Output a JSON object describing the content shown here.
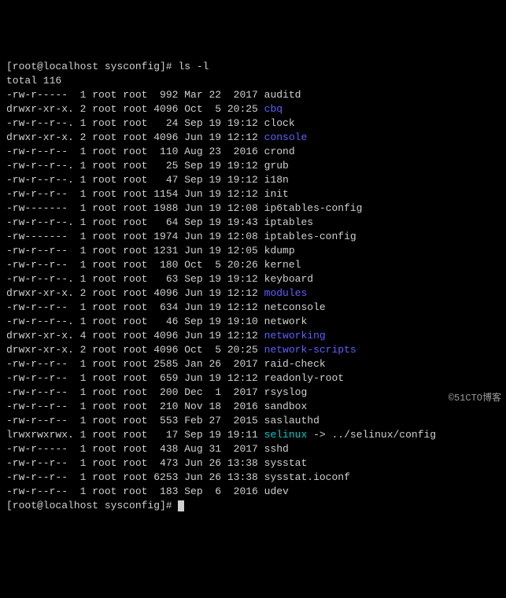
{
  "prompt": {
    "user": "root",
    "host": "localhost",
    "cwd": "sysconfig",
    "symbol": "#"
  },
  "command": "ls -l",
  "total_line": "total 116",
  "files": [
    {
      "perms": "-rw-r-----",
      "links": "1",
      "owner": "root",
      "group": "root",
      "size": "992",
      "date": "Mar 22  2017",
      "name": "auditd",
      "type": "file"
    },
    {
      "perms": "drwxr-xr-x.",
      "links": "2",
      "owner": "root",
      "group": "root",
      "size": "4096",
      "date": "Oct  5 20:25",
      "name": "cbq",
      "type": "dir"
    },
    {
      "perms": "-rw-r--r--.",
      "links": "1",
      "owner": "root",
      "group": "root",
      "size": "24",
      "date": "Sep 19 19:12",
      "name": "clock",
      "type": "file"
    },
    {
      "perms": "drwxr-xr-x.",
      "links": "2",
      "owner": "root",
      "group": "root",
      "size": "4096",
      "date": "Jun 19 12:12",
      "name": "console",
      "type": "dir"
    },
    {
      "perms": "-rw-r--r--",
      "links": "1",
      "owner": "root",
      "group": "root",
      "size": "110",
      "date": "Aug 23  2016",
      "name": "crond",
      "type": "file"
    },
    {
      "perms": "-rw-r--r--.",
      "links": "1",
      "owner": "root",
      "group": "root",
      "size": "25",
      "date": "Sep 19 19:12",
      "name": "grub",
      "type": "file"
    },
    {
      "perms": "-rw-r--r--.",
      "links": "1",
      "owner": "root",
      "group": "root",
      "size": "47",
      "date": "Sep 19 19:12",
      "name": "i18n",
      "type": "file"
    },
    {
      "perms": "-rw-r--r--",
      "links": "1",
      "owner": "root",
      "group": "root",
      "size": "1154",
      "date": "Jun 19 12:12",
      "name": "init",
      "type": "file"
    },
    {
      "perms": "-rw-------",
      "links": "1",
      "owner": "root",
      "group": "root",
      "size": "1988",
      "date": "Jun 19 12:08",
      "name": "ip6tables-config",
      "type": "file"
    },
    {
      "perms": "-rw-r--r--.",
      "links": "1",
      "owner": "root",
      "group": "root",
      "size": "64",
      "date": "Sep 19 19:43",
      "name": "iptables",
      "type": "file"
    },
    {
      "perms": "-rw-------",
      "links": "1",
      "owner": "root",
      "group": "root",
      "size": "1974",
      "date": "Jun 19 12:08",
      "name": "iptables-config",
      "type": "file"
    },
    {
      "perms": "-rw-r--r--",
      "links": "1",
      "owner": "root",
      "group": "root",
      "size": "1231",
      "date": "Jun 19 12:05",
      "name": "kdump",
      "type": "file"
    },
    {
      "perms": "-rw-r--r--",
      "links": "1",
      "owner": "root",
      "group": "root",
      "size": "180",
      "date": "Oct  5 20:26",
      "name": "kernel",
      "type": "file"
    },
    {
      "perms": "-rw-r--r--.",
      "links": "1",
      "owner": "root",
      "group": "root",
      "size": "63",
      "date": "Sep 19 19:12",
      "name": "keyboard",
      "type": "file"
    },
    {
      "perms": "drwxr-xr-x.",
      "links": "2",
      "owner": "root",
      "group": "root",
      "size": "4096",
      "date": "Jun 19 12:12",
      "name": "modules",
      "type": "dir"
    },
    {
      "perms": "-rw-r--r--",
      "links": "1",
      "owner": "root",
      "group": "root",
      "size": "634",
      "date": "Jun 19 12:12",
      "name": "netconsole",
      "type": "file"
    },
    {
      "perms": "-rw-r--r--.",
      "links": "1",
      "owner": "root",
      "group": "root",
      "size": "46",
      "date": "Sep 19 19:10",
      "name": "network",
      "type": "file"
    },
    {
      "perms": "drwxr-xr-x.",
      "links": "4",
      "owner": "root",
      "group": "root",
      "size": "4096",
      "date": "Jun 19 12:12",
      "name": "networking",
      "type": "dir"
    },
    {
      "perms": "drwxr-xr-x.",
      "links": "2",
      "owner": "root",
      "group": "root",
      "size": "4096",
      "date": "Oct  5 20:25",
      "name": "network-scripts",
      "type": "dir"
    },
    {
      "perms": "-rw-r--r--",
      "links": "1",
      "owner": "root",
      "group": "root",
      "size": "2585",
      "date": "Jan 26  2017",
      "name": "raid-check",
      "type": "file"
    },
    {
      "perms": "-rw-r--r--",
      "links": "1",
      "owner": "root",
      "group": "root",
      "size": "659",
      "date": "Jun 19 12:12",
      "name": "readonly-root",
      "type": "file"
    },
    {
      "perms": "-rw-r--r--",
      "links": "1",
      "owner": "root",
      "group": "root",
      "size": "200",
      "date": "Dec  1  2017",
      "name": "rsyslog",
      "type": "file"
    },
    {
      "perms": "-rw-r--r--",
      "links": "1",
      "owner": "root",
      "group": "root",
      "size": "210",
      "date": "Nov 18  2016",
      "name": "sandbox",
      "type": "file"
    },
    {
      "perms": "-rw-r--r--",
      "links": "1",
      "owner": "root",
      "group": "root",
      "size": "553",
      "date": "Feb 27  2015",
      "name": "saslauthd",
      "type": "file"
    },
    {
      "perms": "lrwxrwxrwx.",
      "links": "1",
      "owner": "root",
      "group": "root",
      "size": "17",
      "date": "Sep 19 19:11",
      "name": "selinux",
      "type": "link",
      "target": "../selinux/config"
    },
    {
      "perms": "-rw-r-----",
      "links": "1",
      "owner": "root",
      "group": "root",
      "size": "438",
      "date": "Aug 31  2017",
      "name": "sshd",
      "type": "file"
    },
    {
      "perms": "-rw-r--r--",
      "links": "1",
      "owner": "root",
      "group": "root",
      "size": "473",
      "date": "Jun 26 13:38",
      "name": "sysstat",
      "type": "file"
    },
    {
      "perms": "-rw-r--r--",
      "links": "1",
      "owner": "root",
      "group": "root",
      "size": "6253",
      "date": "Jun 26 13:38",
      "name": "sysstat.ioconf",
      "type": "file"
    },
    {
      "perms": "-rw-r--r--",
      "links": "1",
      "owner": "root",
      "group": "root",
      "size": "183",
      "date": "Sep  6  2016",
      "name": "udev",
      "type": "file"
    }
  ],
  "watermark": "©51CTO博客"
}
